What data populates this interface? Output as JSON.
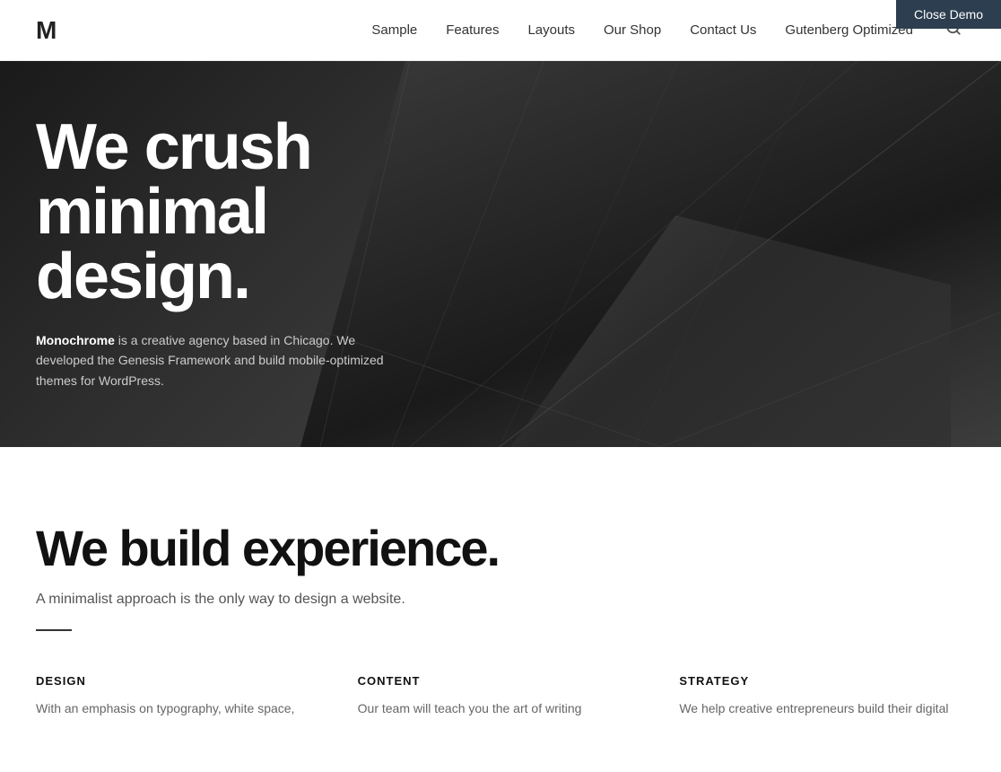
{
  "demo_bar": {
    "label": "Close Demo"
  },
  "header": {
    "logo": "M",
    "nav_items": [
      {
        "label": "Sample",
        "href": "#"
      },
      {
        "label": "Features",
        "href": "#"
      },
      {
        "label": "Layouts",
        "href": "#"
      },
      {
        "label": "Our Shop",
        "href": "#"
      },
      {
        "label": "Contact Us",
        "href": "#"
      },
      {
        "label": "Gutenberg Optimized",
        "href": "#"
      }
    ],
    "search_icon": "🔍"
  },
  "hero": {
    "title": "We crush minimal design.",
    "description_bold": "Monochrome",
    "description_rest": " is a creative agency based in Chicago. We developed the Genesis Framework and build mobile-optimized themes for WordPress."
  },
  "main": {
    "title": "We build experience.",
    "subtitle": "A minimalist approach is the only way to design a website.",
    "columns": [
      {
        "heading": "DESIGN",
        "text": "With an emphasis on typography, white space,"
      },
      {
        "heading": "CONTENT",
        "text": "Our team will teach you the art of writing"
      },
      {
        "heading": "STRATEGY",
        "text": "We help creative entrepreneurs build their digital"
      }
    ]
  }
}
